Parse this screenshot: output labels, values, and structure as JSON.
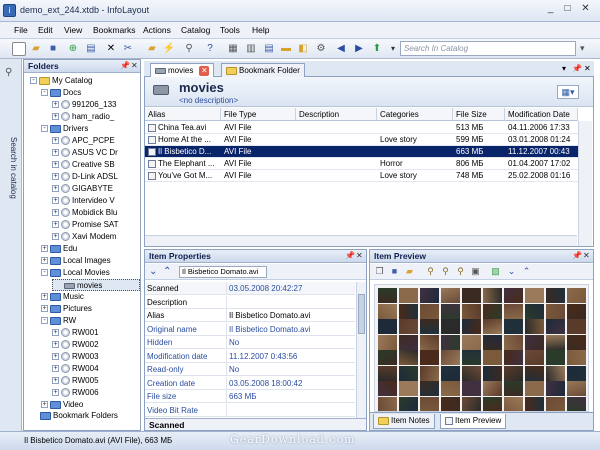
{
  "window": {
    "title": "demo_ext_244.xtdb - InfoLayout",
    "controls": [
      "_",
      "□",
      "✕"
    ]
  },
  "menu": [
    "File",
    "Edit",
    "View",
    "Bookmarks",
    "Actions",
    "Catalog",
    "Tools",
    "Help"
  ],
  "toolbar": {
    "search_placeholder": "Search In Catalog"
  },
  "left_strip": {
    "label": "Search in catalog"
  },
  "folders": {
    "title": "Folders",
    "rows": [
      {
        "label": "My Catalog",
        "indent": 0,
        "exp": "-",
        "icon": "folder-open"
      },
      {
        "label": "Docs",
        "indent": 1,
        "exp": "-",
        "icon": "folder"
      },
      {
        "label": "991206_133",
        "indent": 2,
        "exp": "+",
        "icon": "cd"
      },
      {
        "label": "ham_radio_",
        "indent": 2,
        "exp": "+",
        "icon": "cd"
      },
      {
        "label": "Drivers",
        "indent": 1,
        "exp": "-",
        "icon": "folder"
      },
      {
        "label": "APC_PCPE",
        "indent": 2,
        "exp": "+",
        "icon": "cd"
      },
      {
        "label": "ASUS VC Dr",
        "indent": 2,
        "exp": "+",
        "icon": "cd"
      },
      {
        "label": "Creative SB",
        "indent": 2,
        "exp": "+",
        "icon": "cd"
      },
      {
        "label": "D-Link ADSL",
        "indent": 2,
        "exp": "+",
        "icon": "cd"
      },
      {
        "label": "GIGABYTE",
        "indent": 2,
        "exp": "+",
        "icon": "cd"
      },
      {
        "label": "Intervideo V",
        "indent": 2,
        "exp": "+",
        "icon": "cd"
      },
      {
        "label": "Mobidick Blu",
        "indent": 2,
        "exp": "+",
        "icon": "cd"
      },
      {
        "label": "Promise SAT",
        "indent": 2,
        "exp": "+",
        "icon": "cd"
      },
      {
        "label": "Xavi Modem",
        "indent": 2,
        "exp": "+",
        "icon": "cd"
      },
      {
        "label": "Edu",
        "indent": 1,
        "exp": "+",
        "icon": "folder"
      },
      {
        "label": "Local Images",
        "indent": 1,
        "exp": "+",
        "icon": "folder"
      },
      {
        "label": "Local Movies",
        "indent": 1,
        "exp": "-",
        "icon": "folder"
      },
      {
        "label": "movies",
        "indent": 2,
        "exp": "",
        "icon": "drive",
        "selected": true
      },
      {
        "label": "Music",
        "indent": 1,
        "exp": "+",
        "icon": "folder"
      },
      {
        "label": "Pictures",
        "indent": 1,
        "exp": "+",
        "icon": "folder"
      },
      {
        "label": "RW",
        "indent": 1,
        "exp": "-",
        "icon": "folder"
      },
      {
        "label": "RW001",
        "indent": 2,
        "exp": "+",
        "icon": "cd"
      },
      {
        "label": "RW002",
        "indent": 2,
        "exp": "+",
        "icon": "cd"
      },
      {
        "label": "RW003",
        "indent": 2,
        "exp": "+",
        "icon": "cd"
      },
      {
        "label": "RW004",
        "indent": 2,
        "exp": "+",
        "icon": "cd"
      },
      {
        "label": "RW005",
        "indent": 2,
        "exp": "+",
        "icon": "cd"
      },
      {
        "label": "RW006",
        "indent": 2,
        "exp": "+",
        "icon": "cd"
      },
      {
        "label": "Video",
        "indent": 1,
        "exp": "+",
        "icon": "folder"
      }
    ],
    "bookmark_folders": "Bookmark Folders"
  },
  "tabs": [
    {
      "label": "movies",
      "active": true
    },
    {
      "label": "Bookmark Folder",
      "active": false
    }
  ],
  "header": {
    "title": "movies",
    "subtitle": "<no description>"
  },
  "table": {
    "columns": [
      "Alias",
      "File Type",
      "Description",
      "Categories",
      "File Size",
      "Modification Date"
    ],
    "rows": [
      [
        "China Tea.avi",
        "AVI File",
        "",
        "",
        "513 МБ",
        "04.11.2006 17:33"
      ],
      [
        "Home At the ...",
        "AVI File",
        "",
        "Love story",
        "599 МБ",
        "03.01.2008 01:24"
      ],
      [
        "Il Bisbetico D...",
        "AVI File",
        "",
        "",
        "663 МБ",
        "11.12.2007 00:43"
      ],
      [
        "The Elephant ...",
        "AVI File",
        "",
        "Horror",
        "806 МБ",
        "01.04.2007 17:02"
      ],
      [
        "You've Got M...",
        "AVI File",
        "",
        "Love story",
        "748 МБ",
        "25.02.2008 01:16"
      ]
    ],
    "selected_row": 2
  },
  "properties": {
    "title": "Item Properties",
    "selector": "Il Bisbetico Domato.avi",
    "rows": [
      {
        "k": "Scanned",
        "v": "03.05.2008 20:42:27",
        "blue": true
      },
      {
        "k": "Description",
        "v": "",
        "blue": false
      },
      {
        "k": "Alias",
        "v": "Il Bisbetico Domato.avi",
        "blue": false
      },
      {
        "k": "Original name",
        "v": "Il Bisbetico Domato.avi",
        "blue": true
      },
      {
        "k": "Hidden",
        "v": "No",
        "blue": true
      },
      {
        "k": "Modification date",
        "v": "11.12.2007 0:43:56",
        "blue": true
      },
      {
        "k": "Read-only",
        "v": "No",
        "blue": true
      },
      {
        "k": "Creation date",
        "v": "03.05.2008 18:00:42",
        "blue": true
      },
      {
        "k": "File size",
        "v": "663 МБ",
        "blue": true
      },
      {
        "k": "Video Bit Rate",
        "v": "",
        "blue": true
      }
    ],
    "footer": "Scanned"
  },
  "preview": {
    "title": "Item Preview",
    "tabs": [
      {
        "label": "Item Notes",
        "active": false
      },
      {
        "label": "Item Preview",
        "active": true
      }
    ]
  },
  "status": "Il Bisbetico Domato.avi (AVI File), 663 МБ",
  "watermark": "GearDownload.com",
  "colors": {
    "selection": "#0a246a",
    "accent": "#2a4da0",
    "frame": "#8ea1c0"
  }
}
